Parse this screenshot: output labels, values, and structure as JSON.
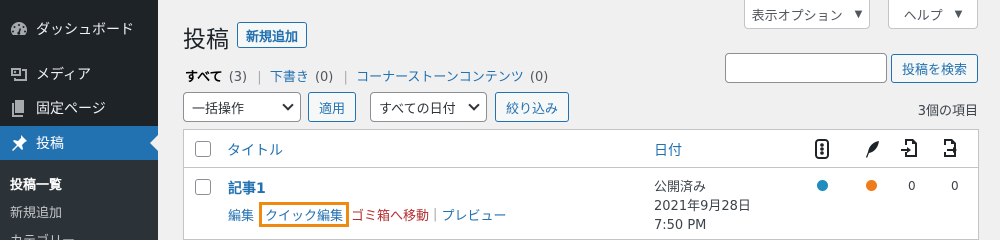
{
  "sidebar": {
    "items": [
      {
        "label": "ダッシュボード",
        "icon": "dashboard-icon"
      },
      {
        "label": "メディア",
        "icon": "media-icon"
      },
      {
        "label": "固定ページ",
        "icon": "page-icon"
      },
      {
        "label": "投稿",
        "icon": "pin-icon",
        "active": true
      }
    ],
    "submenu": [
      "投稿一覧",
      "新規追加",
      "カテゴリー"
    ]
  },
  "header": {
    "screen_options": "表示オプション",
    "help": "ヘルプ",
    "title": "投稿",
    "add_new": "新規追加"
  },
  "filters": {
    "all": {
      "label": "すべて",
      "count": "(3)"
    },
    "drafts": {
      "label": "下書き",
      "count": "(0)"
    },
    "cornerstone": {
      "label": "コーナーストーンコンテンツ",
      "count": "(0)"
    }
  },
  "search": {
    "placeholder": "",
    "button": "投稿を検索"
  },
  "toolbar": {
    "bulk_action": "一括操作",
    "apply": "適用",
    "dates": "すべての日付",
    "filter": "絞り込み",
    "item_count": "3個の項目"
  },
  "table": {
    "columns": {
      "title": "タイトル",
      "date": "日付",
      "icons": [
        "seo-score-icon",
        "readability-icon",
        "incoming-links-icon",
        "outgoing-links-icon"
      ]
    },
    "rows": [
      {
        "title": "記事1",
        "actions": {
          "edit": "編集",
          "quick_edit": "クイック編集",
          "trash": "ゴミ箱へ移動",
          "preview": "プレビュー"
        },
        "status": "公開済み",
        "date": "2021年9月28日 7:50 PM",
        "seo_color": "#1e8cbe",
        "readability_color": "#ee7c1b",
        "incoming": "0",
        "outgoing": "0"
      }
    ]
  },
  "colors": {
    "accent": "#2271b1",
    "highlight": "#f0890f",
    "sidebar": "#1d2327"
  }
}
